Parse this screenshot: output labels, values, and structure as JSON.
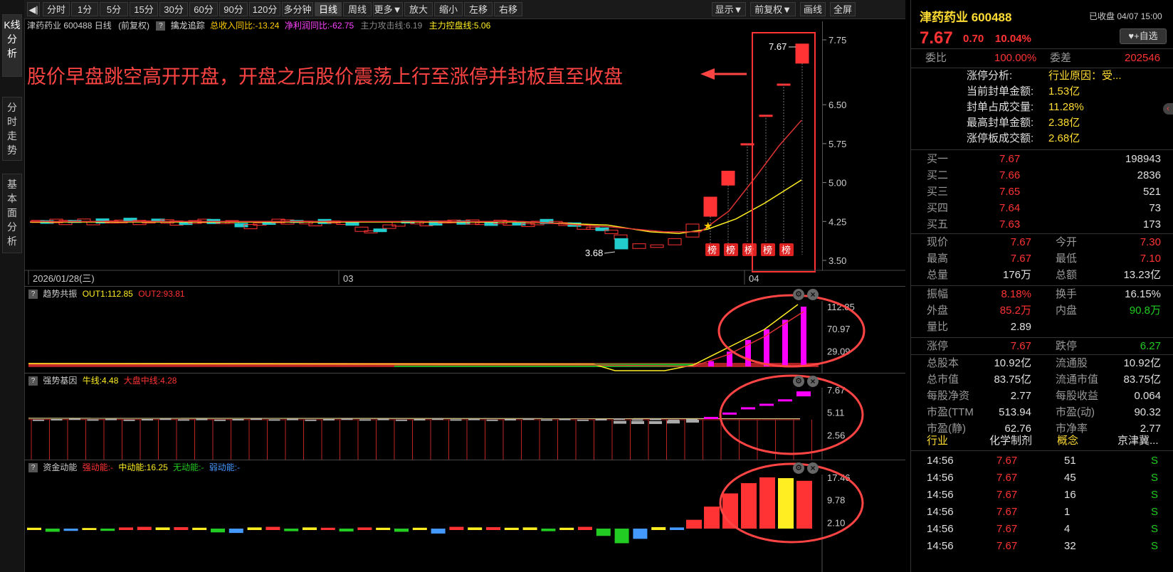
{
  "toolbar": {
    "back": "◀|",
    "items": [
      "分时",
      "1分",
      "5分",
      "15分",
      "30分",
      "60分",
      "90分",
      "120分",
      "多分钟",
      "日线",
      "周线",
      "更多▼",
      "放大",
      "缩小",
      "左移",
      "右移"
    ],
    "right": [
      "显示▼",
      "前复权▼",
      "画线",
      "全屏"
    ],
    "active": "日线"
  },
  "leftnav": [
    {
      "label": "K线分析",
      "active": true
    },
    {
      "label": "分时走势",
      "active": false
    },
    {
      "label": "基本面分析",
      "active": false
    }
  ],
  "main": {
    "title": "津药药业 600488 日线",
    "adj": "(前复权)",
    "indicator": "擒龙追踪",
    "rev": "总收入同比:-13.24",
    "profit": "净利润同比:-62.75",
    "attack": "主力攻击线:6.19",
    "control": "主力控盘线:5.06",
    "annotation": "股价早盘跳空高开开盘，开盘之后股价震荡上行至涨停并封板直至收盘",
    "arrow": "◀━━",
    "price_label_high": "7.67",
    "price_label_low": "3.68",
    "bang": "榜",
    "yaxis": [
      "7.75",
      "6.50",
      "5.75",
      "5.00",
      "4.25",
      "3.50"
    ],
    "dates": [
      "2026/01/28(三)",
      "03",
      "04"
    ]
  },
  "trend": {
    "name": "趋势共振",
    "out1": "OUT1:112.85",
    "out2": "OUT2:93.81",
    "yaxis": [
      "112.85",
      "70.97",
      "29.09"
    ]
  },
  "strong": {
    "name": "强势基因",
    "bull": "牛线:4.48",
    "market": "大盘中线:4.28",
    "yaxis": [
      "7.67",
      "5.11",
      "2.56"
    ]
  },
  "fund": {
    "name": "资金动能",
    "s1": "强动能:-",
    "s2": "中动能:16.25",
    "s3": "无动能:-",
    "s4": "弱动能:-",
    "yaxis": [
      "17.46",
      "9.78",
      "2.10"
    ]
  },
  "quote": {
    "name": "津药药业 600488",
    "status": "已收盘 04/07 15:00",
    "price": "7.67",
    "chg": "0.70",
    "pct": "10.04%",
    "watch": "+自选",
    "weibi_label": "委比",
    "weibi": "100.00%",
    "weicha_label": "委差",
    "weicha": "202546",
    "limit_info": [
      {
        "k": "涨停分析:",
        "v": "行业原因：受..."
      },
      {
        "k": "当前封单金额:",
        "v": "1.53亿"
      },
      {
        "k": "封单占成交量:",
        "v": "11.28%"
      },
      {
        "k": "最高封单金额:",
        "v": "2.38亿"
      },
      {
        "k": "涨停板成交额:",
        "v": "2.68亿"
      }
    ],
    "bids": [
      {
        "k": "买一",
        "p": "7.67",
        "v": "198943"
      },
      {
        "k": "买二",
        "p": "7.66",
        "v": "2836"
      },
      {
        "k": "买三",
        "p": "7.65",
        "v": "521"
      },
      {
        "k": "买四",
        "p": "7.64",
        "v": "73"
      },
      {
        "k": "买五",
        "p": "7.63",
        "v": "173"
      }
    ],
    "stats1": [
      {
        "k1": "现价",
        "v1": "7.67",
        "c1": "red",
        "k2": "今开",
        "v2": "7.30",
        "c2": "red"
      },
      {
        "k1": "最高",
        "v1": "7.67",
        "c1": "red",
        "k2": "最低",
        "v2": "7.10",
        "c2": "red"
      },
      {
        "k1": "总量",
        "v1": "176万",
        "c1": "white",
        "k2": "总额",
        "v2": "13.23亿",
        "c2": "white"
      }
    ],
    "stats2": [
      {
        "k1": "振幅",
        "v1": "8.18%",
        "c1": "red",
        "k2": "换手",
        "v2": "16.15%",
        "c2": "white"
      },
      {
        "k1": "外盘",
        "v1": "85.2万",
        "c1": "red",
        "k2": "内盘",
        "v2": "90.8万",
        "c2": "green"
      },
      {
        "k1": "量比",
        "v1": "2.89",
        "c1": "white",
        "k2": "",
        "v2": "",
        "c2": "white"
      }
    ],
    "stats3": [
      {
        "k1": "涨停",
        "v1": "7.67",
        "c1": "red",
        "k2": "跌停",
        "v2": "6.27",
        "c2": "green"
      }
    ],
    "stats4": [
      {
        "k1": "总股本",
        "v1": "10.92亿",
        "k2": "流通股",
        "v2": "10.92亿"
      },
      {
        "k1": "总市值",
        "v1": "83.75亿",
        "k2": "流通市值",
        "v2": "83.75亿"
      },
      {
        "k1": "每股净资",
        "v1": "2.77",
        "k2": "每股收益",
        "v2": "0.064"
      },
      {
        "k1": "市盈(TTM",
        "v1": "513.94",
        "k2": "市盈(动)",
        "v2": "90.32"
      },
      {
        "k1": "市盈(静)",
        "v1": "62.76",
        "k2": "市净率",
        "v2": "2.77"
      }
    ],
    "industry_label": "行业",
    "industry": "化学制剂",
    "concept_label": "概念",
    "concept": "京津冀...",
    "ticks": [
      {
        "t": "14:56",
        "p": "7.67",
        "v": "51",
        "d": "S"
      },
      {
        "t": "14:56",
        "p": "7.67",
        "v": "45",
        "d": "S"
      },
      {
        "t": "14:56",
        "p": "7.67",
        "v": "16",
        "d": "S"
      },
      {
        "t": "14:56",
        "p": "7.67",
        "v": "1",
        "d": "S"
      },
      {
        "t": "14:56",
        "p": "7.67",
        "v": "4",
        "d": "S"
      },
      {
        "t": "14:56",
        "p": "7.67",
        "v": "32",
        "d": "S"
      }
    ]
  },
  "colors": {
    "up": "#ff3333",
    "down": "#22cccc",
    "ma1": "#ffee22",
    "ma2": "#dd3333",
    "annot": "#ff4444",
    "pink": "#ff00ff"
  }
}
